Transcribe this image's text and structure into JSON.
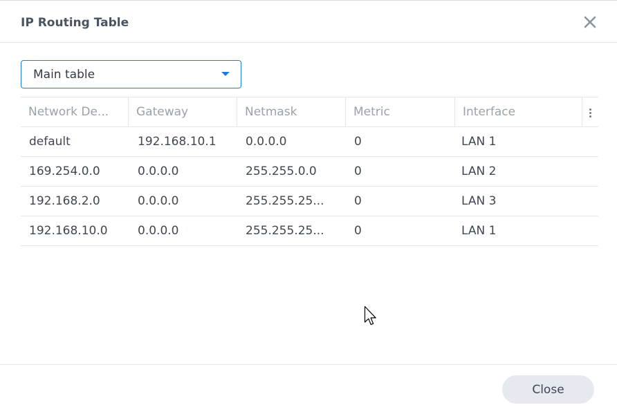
{
  "dialog": {
    "title": "IP Routing Table",
    "close_icon": "close-icon"
  },
  "table_select": {
    "value": "Main table",
    "caret_icon": "caret-down-icon"
  },
  "table": {
    "columns": [
      "Network De...",
      "Gateway",
      "Netmask",
      "Metric",
      "Interface"
    ],
    "column_menu_icon": "vertical-dots-icon",
    "rows": [
      [
        "default",
        "192.168.10.1",
        "0.0.0.0",
        "0",
        "LAN 1"
      ],
      [
        "169.254.0.0",
        "0.0.0.0",
        "255.255.0.0",
        "0",
        "LAN 2"
      ],
      [
        "192.168.2.0",
        "0.0.0.0",
        "255.255.25...",
        "0",
        "LAN 3"
      ],
      [
        "192.168.10.0",
        "0.0.0.0",
        "255.255.25...",
        "0",
        "LAN 1"
      ]
    ]
  },
  "footer": {
    "close_label": "Close"
  },
  "colors": {
    "accent": "#1c7ed3",
    "button_bg": "#e6eaf0",
    "header_text": "#98a2ad"
  }
}
